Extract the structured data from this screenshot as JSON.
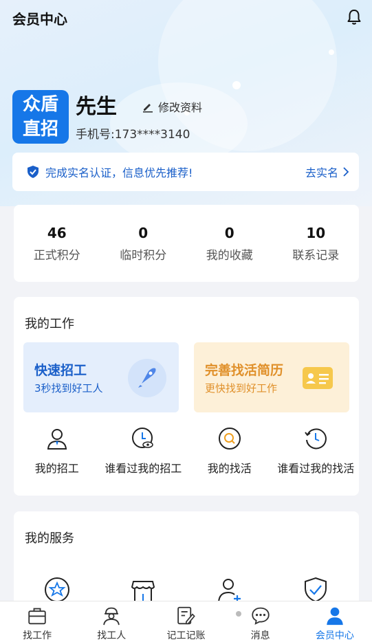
{
  "header": {
    "title": "会员中心",
    "bell_icon": "bell-icon"
  },
  "profile": {
    "logo_line1": "众盾",
    "logo_line2": "直招",
    "name": "先生",
    "edit_label": "修改资料",
    "phone": "手机号:173****3140"
  },
  "verify": {
    "text": "完成实名认证，信息优先推荐!",
    "action": "去实名"
  },
  "stats": [
    {
      "value": "46",
      "label": "正式积分"
    },
    {
      "value": "0",
      "label": "临时积分"
    },
    {
      "value": "0",
      "label": "我的收藏"
    },
    {
      "value": "10",
      "label": "联系记录"
    }
  ],
  "work": {
    "title": "我的工作",
    "promo_a": {
      "title": "快速招工",
      "subtitle": "3秒找到好工人",
      "icon": "rocket-icon"
    },
    "promo_b": {
      "title": "完善找活简历",
      "subtitle": "更快找到好工作",
      "icon": "resume-card-icon"
    },
    "items": [
      {
        "label": "我的招工",
        "icon": "worker-icon"
      },
      {
        "label": "谁看过我的招工",
        "icon": "clock-eye-icon"
      },
      {
        "label": "我的找活",
        "icon": "search-circle-icon"
      },
      {
        "label": "谁看过我的找活",
        "icon": "history-icon"
      }
    ]
  },
  "service": {
    "title": "我的服务"
  },
  "tabbar": [
    {
      "label": "找工作",
      "icon": "briefcase-icon"
    },
    {
      "label": "找工人",
      "icon": "helmet-worker-icon"
    },
    {
      "label": "记工记账",
      "icon": "notebook-pen-icon"
    },
    {
      "label": "消息",
      "icon": "chat-bubble-icon"
    },
    {
      "label": "会员中心",
      "icon": "user-icon"
    }
  ],
  "colors": {
    "accent": "#1677e8",
    "promo_blue_bg": "#e4eefc",
    "promo_orange_bg": "#fdf0d8",
    "promo_orange_text": "#e0902a"
  }
}
